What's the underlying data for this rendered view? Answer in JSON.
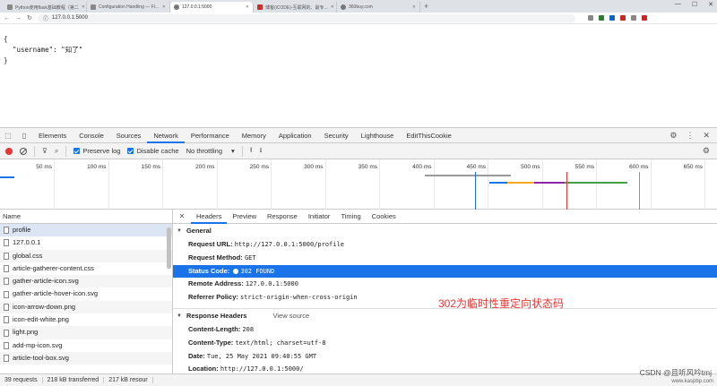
{
  "browser": {
    "tabs": [
      {
        "title": "Python使用flask基础教程（第二",
        "favicon": "gray",
        "active": false
      },
      {
        "title": "Configuration Handling — Fl...",
        "favicon": "gray",
        "active": false
      },
      {
        "title": "127.0.0.1:5000",
        "favicon": "globe",
        "active": true
      },
      {
        "title": "博客(iCODE)-互联网的、最专...",
        "favicon": "red",
        "active": false
      },
      {
        "title": "360buy.com",
        "favicon": "globe",
        "active": false
      }
    ],
    "url": "127.0.0.1:5000"
  },
  "page": {
    "open_brace": "{",
    "line": "\"username\": \"知了\"",
    "close_brace": "}"
  },
  "devtools": {
    "tabs": [
      "Elements",
      "Console",
      "Sources",
      "Network",
      "Performance",
      "Memory",
      "Application",
      "Security",
      "Lighthouse",
      "EditThisCookie"
    ],
    "active_tab": "Network",
    "toolbar": {
      "preserve_log": "Preserve log",
      "disable_cache": "Disable cache",
      "throttling": "No throttling"
    },
    "timeline_ticks": [
      "50 ms",
      "100 ms",
      "150 ms",
      "200 ms",
      "250 ms",
      "300 ms",
      "350 ms",
      "400 ms",
      "450 ms",
      "500 ms",
      "550 ms",
      "600 ms",
      "650 ms"
    ],
    "list_header": "Name",
    "requests": [
      "profile",
      "127.0.0.1",
      "global.css",
      "article-gatherer-content.css",
      "gather-article-icon.svg",
      "gather-article-hover-icon.svg",
      "icon-arrow-down.png",
      "icon-edit-white.png",
      "light.png",
      "add-mp-icon.svg",
      "article-tool-box.svg"
    ],
    "detail_tabs": [
      "Headers",
      "Preview",
      "Response",
      "Initiator",
      "Timing",
      "Cookies"
    ],
    "general": {
      "title": "General",
      "request_url_label": "Request URL:",
      "request_url": "http://127.0.0.1:5000/profile",
      "request_method_label": "Request Method:",
      "request_method": "GET",
      "status_code_label": "Status Code:",
      "status_code": "302 FOUND",
      "remote_address_label": "Remote Address:",
      "remote_address": "127.0.0.1:5000",
      "referrer_policy_label": "Referrer Policy:",
      "referrer_policy": "strict-origin-when-cross-origin"
    },
    "annotation": "302为临时性重定向状态码",
    "response_headers": {
      "title": "Response Headers",
      "view_source": "View source",
      "content_length_label": "Content-Length:",
      "content_length": "208",
      "content_type_label": "Content-Type:",
      "content_type": "text/html; charset=utf-8",
      "date_label": "Date:",
      "date": "Tue, 25 May 2021 09:40:55 GMT",
      "location_label": "Location:",
      "location": "http://127.0.0.1:5000/"
    },
    "status_bar": {
      "requests": "39 requests",
      "transferred": "218 kB transferred",
      "resources": "217 kB resour"
    }
  },
  "watermark": "CSDN @且听风吟tmj",
  "watermark_site": "www.kaspbp.com",
  "colors": {
    "accent": "#1a73e8",
    "record": "#e53935",
    "annotation": "#e53935"
  }
}
